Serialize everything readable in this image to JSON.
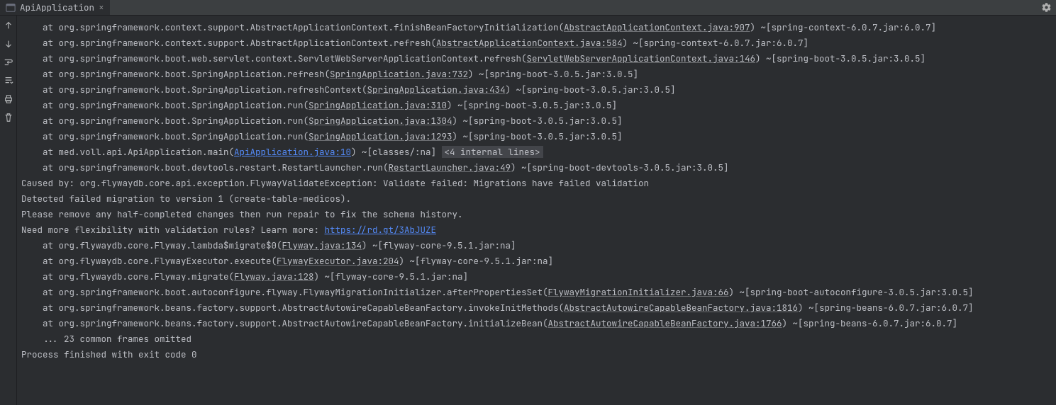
{
  "tab": {
    "title": "ApiApplication"
  },
  "lines": [
    {
      "indent": "    at ",
      "pre": "org.springframework.context.support.AbstractApplicationContext.finishBeanFactoryInitialization(",
      "link": "AbstractApplicationContext.java:907",
      "post": ") ~[spring-context-6.0.7.jar:6.0.7]"
    },
    {
      "indent": "    at ",
      "pre": "org.springframework.context.support.AbstractApplicationContext.refresh(",
      "link": "AbstractApplicationContext.java:584",
      "post": ") ~[spring-context-6.0.7.jar:6.0.7]"
    },
    {
      "indent": "    at ",
      "pre": "org.springframework.boot.web.servlet.context.ServletWebServerApplicationContext.refresh(",
      "link": "ServletWebServerApplicationContext.java:146",
      "post": ") ~[spring-boot-3.0.5.jar:3.0.5]"
    },
    {
      "indent": "    at ",
      "pre": "org.springframework.boot.SpringApplication.refresh(",
      "link": "SpringApplication.java:732",
      "post": ") ~[spring-boot-3.0.5.jar:3.0.5]"
    },
    {
      "indent": "    at ",
      "pre": "org.springframework.boot.SpringApplication.refreshContext(",
      "link": "SpringApplication.java:434",
      "post": ") ~[spring-boot-3.0.5.jar:3.0.5]"
    },
    {
      "indent": "    at ",
      "pre": "org.springframework.boot.SpringApplication.run(",
      "link": "SpringApplication.java:310",
      "post": ") ~[spring-boot-3.0.5.jar:3.0.5]"
    },
    {
      "indent": "    at ",
      "pre": "org.springframework.boot.SpringApplication.run(",
      "link": "SpringApplication.java:1304",
      "post": ") ~[spring-boot-3.0.5.jar:3.0.5]"
    },
    {
      "indent": "    at ",
      "pre": "org.springframework.boot.SpringApplication.run(",
      "link": "SpringApplication.java:1293",
      "post": ") ~[spring-boot-3.0.5.jar:3.0.5]"
    },
    {
      "expand": true,
      "indent": "    at ",
      "pre": "med.voll.api.ApiApplication.main(",
      "link": "ApiApplication.java:10",
      "linkBlue": true,
      "post": ") ~[classes/:na] ",
      "badge": "<4 internal lines>"
    },
    {
      "indent": "    at ",
      "pre": "org.springframework.boot.devtools.restart.RestartLauncher.run(",
      "link": "RestartLauncher.java:49",
      "post": ") ~[spring-boot-devtools-3.0.5.jar:3.0.5]"
    },
    {
      "plain": "Caused by: org.flywaydb.core.api.exception.FlywayValidateException: Validate failed: Migrations have failed validation"
    },
    {
      "plain": "Detected failed migration to version 1 (create-table-medicos)."
    },
    {
      "plain": "Please remove any half-completed changes then run repair to fix the schema history."
    },
    {
      "preText": "Need more flexibility with validation rules? Learn more: ",
      "urlBlue": "https://rd.gt/3AbJUZE"
    },
    {
      "indent": "    at ",
      "pre": "org.flywaydb.core.Flyway.lambda$migrate$0(",
      "link": "Flyway.java:134",
      "post": ") ~[flyway-core-9.5.1.jar:na]"
    },
    {
      "indent": "    at ",
      "pre": "org.flywaydb.core.FlywayExecutor.execute(",
      "link": "FlywayExecutor.java:204",
      "post": ") ~[flyway-core-9.5.1.jar:na]"
    },
    {
      "indent": "    at ",
      "pre": "org.flywaydb.core.Flyway.migrate(",
      "link": "Flyway.java:128",
      "post": ") ~[flyway-core-9.5.1.jar:na]"
    },
    {
      "indent": "    at ",
      "pre": "org.springframework.boot.autoconfigure.flyway.FlywayMigrationInitializer.afterPropertiesSet(",
      "link": "FlywayMigrationInitializer.java:66",
      "post": ") ~[spring-boot-autoconfigure-3.0.5.jar:3.0.5]"
    },
    {
      "indent": "    at ",
      "pre": "org.springframework.beans.factory.support.AbstractAutowireCapableBeanFactory.invokeInitMethods(",
      "link": "AbstractAutowireCapableBeanFactory.java:1816",
      "post": ") ~[spring-beans-6.0.7.jar:6.0.7]"
    },
    {
      "indent": "    at ",
      "pre": "org.springframework.beans.factory.support.AbstractAutowireCapableBeanFactory.initializeBean(",
      "link": "AbstractAutowireCapableBeanFactory.java:1766",
      "post": ") ~[spring-beans-6.0.7.jar:6.0.7]"
    },
    {
      "plain": "    ... 23 common frames omitted"
    },
    {
      "plain": ""
    },
    {
      "plain": ""
    },
    {
      "plain": "Process finished with exit code 0"
    }
  ]
}
